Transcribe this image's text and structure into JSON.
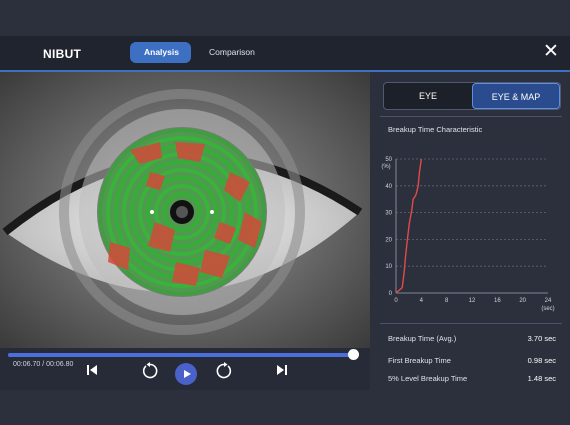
{
  "header": {
    "title": "NIBUT",
    "tabs": [
      {
        "label": "Analysis"
      },
      {
        "label": "Comparison"
      }
    ]
  },
  "player": {
    "current_time": "00:06.70",
    "separator": "/",
    "total_time": "00:06.80",
    "progress": 0.985
  },
  "right_panel": {
    "toggle": [
      {
        "label": "EYE"
      },
      {
        "label": "EYE & MAP"
      }
    ],
    "chart_title": "Breakup Time Characteristic",
    "stats": [
      {
        "label": "Breakup Time (Avg.)",
        "value": "3.70 sec"
      },
      {
        "label": "First Breakup Time",
        "value": "0.98 sec"
      },
      {
        "label": "5% Level Breakup Time",
        "value": "1.48 sec"
      }
    ]
  },
  "chart_data": {
    "type": "line",
    "title": "Breakup Time Characteristic",
    "ylabel": "(%)",
    "xlabel": "(sec)",
    "ylim": [
      0,
      50
    ],
    "xlim": [
      0,
      24
    ],
    "yticks": [
      0,
      10,
      20,
      30,
      40,
      50
    ],
    "xticks": [
      0,
      4,
      8,
      12,
      16,
      20,
      24
    ],
    "grid": true,
    "series": [
      {
        "color": "#e24a4a",
        "x": [
          0,
          0.98,
          1.3,
          1.48,
          1.8,
          2.1,
          2.5,
          2.7,
          3.0,
          3.2,
          3.5,
          3.7,
          4.0
        ],
        "y": [
          0,
          2,
          8,
          13,
          20,
          26,
          31,
          35,
          36,
          37,
          40,
          45,
          50
        ]
      }
    ]
  }
}
